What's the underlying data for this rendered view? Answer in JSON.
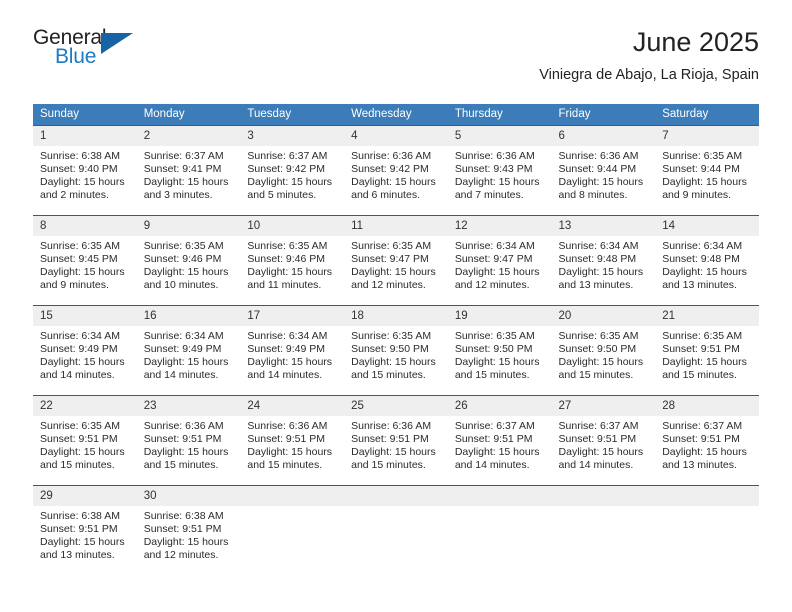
{
  "brand": {
    "name_top": "General",
    "name_bottom": "Blue",
    "triangle_color": "#1763a5",
    "blue_color": "#1e7bc1",
    "dark_color": "#231f20"
  },
  "header": {
    "month_title": "June 2025",
    "location": "Viniegra de Abajo, La Rioja, Spain"
  },
  "theme": {
    "header_bg": "#3c7cb8",
    "row_divider": "#1763a5",
    "day_number_bg": "#efefef",
    "text": "#2b2b2b"
  },
  "weekdays": [
    "Sunday",
    "Monday",
    "Tuesday",
    "Wednesday",
    "Thursday",
    "Friday",
    "Saturday"
  ],
  "weeks": [
    [
      {
        "day": "1",
        "sunrise": "Sunrise: 6:38 AM",
        "sunset": "Sunset: 9:40 PM",
        "daylight_line1": "Daylight: 15 hours",
        "daylight_line2": "and 2 minutes."
      },
      {
        "day": "2",
        "sunrise": "Sunrise: 6:37 AM",
        "sunset": "Sunset: 9:41 PM",
        "daylight_line1": "Daylight: 15 hours",
        "daylight_line2": "and 3 minutes."
      },
      {
        "day": "3",
        "sunrise": "Sunrise: 6:37 AM",
        "sunset": "Sunset: 9:42 PM",
        "daylight_line1": "Daylight: 15 hours",
        "daylight_line2": "and 5 minutes."
      },
      {
        "day": "4",
        "sunrise": "Sunrise: 6:36 AM",
        "sunset": "Sunset: 9:42 PM",
        "daylight_line1": "Daylight: 15 hours",
        "daylight_line2": "and 6 minutes."
      },
      {
        "day": "5",
        "sunrise": "Sunrise: 6:36 AM",
        "sunset": "Sunset: 9:43 PM",
        "daylight_line1": "Daylight: 15 hours",
        "daylight_line2": "and 7 minutes."
      },
      {
        "day": "6",
        "sunrise": "Sunrise: 6:36 AM",
        "sunset": "Sunset: 9:44 PM",
        "daylight_line1": "Daylight: 15 hours",
        "daylight_line2": "and 8 minutes."
      },
      {
        "day": "7",
        "sunrise": "Sunrise: 6:35 AM",
        "sunset": "Sunset: 9:44 PM",
        "daylight_line1": "Daylight: 15 hours",
        "daylight_line2": "and 9 minutes."
      }
    ],
    [
      {
        "day": "8",
        "sunrise": "Sunrise: 6:35 AM",
        "sunset": "Sunset: 9:45 PM",
        "daylight_line1": "Daylight: 15 hours",
        "daylight_line2": "and 9 minutes."
      },
      {
        "day": "9",
        "sunrise": "Sunrise: 6:35 AM",
        "sunset": "Sunset: 9:46 PM",
        "daylight_line1": "Daylight: 15 hours",
        "daylight_line2": "and 10 minutes."
      },
      {
        "day": "10",
        "sunrise": "Sunrise: 6:35 AM",
        "sunset": "Sunset: 9:46 PM",
        "daylight_line1": "Daylight: 15 hours",
        "daylight_line2": "and 11 minutes."
      },
      {
        "day": "11",
        "sunrise": "Sunrise: 6:35 AM",
        "sunset": "Sunset: 9:47 PM",
        "daylight_line1": "Daylight: 15 hours",
        "daylight_line2": "and 12 minutes."
      },
      {
        "day": "12",
        "sunrise": "Sunrise: 6:34 AM",
        "sunset": "Sunset: 9:47 PM",
        "daylight_line1": "Daylight: 15 hours",
        "daylight_line2": "and 12 minutes."
      },
      {
        "day": "13",
        "sunrise": "Sunrise: 6:34 AM",
        "sunset": "Sunset: 9:48 PM",
        "daylight_line1": "Daylight: 15 hours",
        "daylight_line2": "and 13 minutes."
      },
      {
        "day": "14",
        "sunrise": "Sunrise: 6:34 AM",
        "sunset": "Sunset: 9:48 PM",
        "daylight_line1": "Daylight: 15 hours",
        "daylight_line2": "and 13 minutes."
      }
    ],
    [
      {
        "day": "15",
        "sunrise": "Sunrise: 6:34 AM",
        "sunset": "Sunset: 9:49 PM",
        "daylight_line1": "Daylight: 15 hours",
        "daylight_line2": "and 14 minutes."
      },
      {
        "day": "16",
        "sunrise": "Sunrise: 6:34 AM",
        "sunset": "Sunset: 9:49 PM",
        "daylight_line1": "Daylight: 15 hours",
        "daylight_line2": "and 14 minutes."
      },
      {
        "day": "17",
        "sunrise": "Sunrise: 6:34 AM",
        "sunset": "Sunset: 9:49 PM",
        "daylight_line1": "Daylight: 15 hours",
        "daylight_line2": "and 14 minutes."
      },
      {
        "day": "18",
        "sunrise": "Sunrise: 6:35 AM",
        "sunset": "Sunset: 9:50 PM",
        "daylight_line1": "Daylight: 15 hours",
        "daylight_line2": "and 15 minutes."
      },
      {
        "day": "19",
        "sunrise": "Sunrise: 6:35 AM",
        "sunset": "Sunset: 9:50 PM",
        "daylight_line1": "Daylight: 15 hours",
        "daylight_line2": "and 15 minutes."
      },
      {
        "day": "20",
        "sunrise": "Sunrise: 6:35 AM",
        "sunset": "Sunset: 9:50 PM",
        "daylight_line1": "Daylight: 15 hours",
        "daylight_line2": "and 15 minutes."
      },
      {
        "day": "21",
        "sunrise": "Sunrise: 6:35 AM",
        "sunset": "Sunset: 9:51 PM",
        "daylight_line1": "Daylight: 15 hours",
        "daylight_line2": "and 15 minutes."
      }
    ],
    [
      {
        "day": "22",
        "sunrise": "Sunrise: 6:35 AM",
        "sunset": "Sunset: 9:51 PM",
        "daylight_line1": "Daylight: 15 hours",
        "daylight_line2": "and 15 minutes."
      },
      {
        "day": "23",
        "sunrise": "Sunrise: 6:36 AM",
        "sunset": "Sunset: 9:51 PM",
        "daylight_line1": "Daylight: 15 hours",
        "daylight_line2": "and 15 minutes."
      },
      {
        "day": "24",
        "sunrise": "Sunrise: 6:36 AM",
        "sunset": "Sunset: 9:51 PM",
        "daylight_line1": "Daylight: 15 hours",
        "daylight_line2": "and 15 minutes."
      },
      {
        "day": "25",
        "sunrise": "Sunrise: 6:36 AM",
        "sunset": "Sunset: 9:51 PM",
        "daylight_line1": "Daylight: 15 hours",
        "daylight_line2": "and 15 minutes."
      },
      {
        "day": "26",
        "sunrise": "Sunrise: 6:37 AM",
        "sunset": "Sunset: 9:51 PM",
        "daylight_line1": "Daylight: 15 hours",
        "daylight_line2": "and 14 minutes."
      },
      {
        "day": "27",
        "sunrise": "Sunrise: 6:37 AM",
        "sunset": "Sunset: 9:51 PM",
        "daylight_line1": "Daylight: 15 hours",
        "daylight_line2": "and 14 minutes."
      },
      {
        "day": "28",
        "sunrise": "Sunrise: 6:37 AM",
        "sunset": "Sunset: 9:51 PM",
        "daylight_line1": "Daylight: 15 hours",
        "daylight_line2": "and 13 minutes."
      }
    ],
    [
      {
        "day": "29",
        "sunrise": "Sunrise: 6:38 AM",
        "sunset": "Sunset: 9:51 PM",
        "daylight_line1": "Daylight: 15 hours",
        "daylight_line2": "and 13 minutes."
      },
      {
        "day": "30",
        "sunrise": "Sunrise: 6:38 AM",
        "sunset": "Sunset: 9:51 PM",
        "daylight_line1": "Daylight: 15 hours",
        "daylight_line2": "and 12 minutes."
      },
      {
        "day": "",
        "sunrise": "",
        "sunset": "",
        "daylight_line1": "",
        "daylight_line2": ""
      },
      {
        "day": "",
        "sunrise": "",
        "sunset": "",
        "daylight_line1": "",
        "daylight_line2": ""
      },
      {
        "day": "",
        "sunrise": "",
        "sunset": "",
        "daylight_line1": "",
        "daylight_line2": ""
      },
      {
        "day": "",
        "sunrise": "",
        "sunset": "",
        "daylight_line1": "",
        "daylight_line2": ""
      },
      {
        "day": "",
        "sunrise": "",
        "sunset": "",
        "daylight_line1": "",
        "daylight_line2": ""
      }
    ]
  ]
}
